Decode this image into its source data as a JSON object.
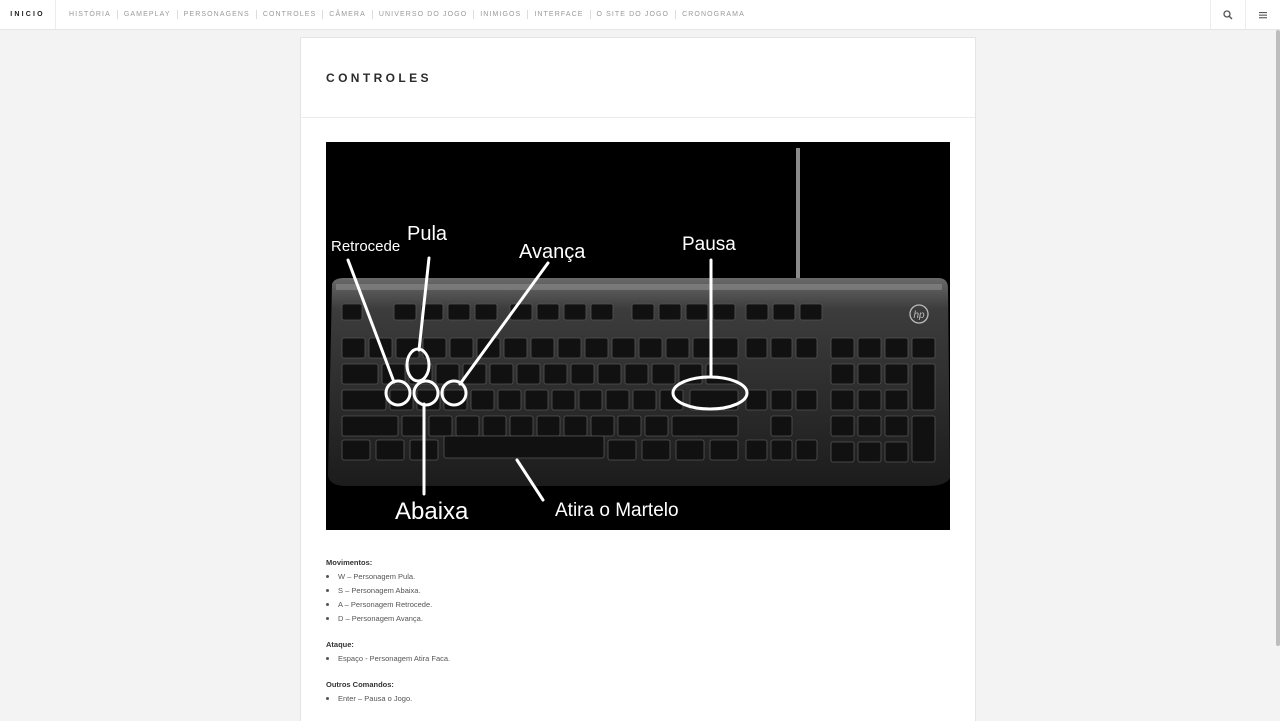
{
  "nav": {
    "brand": "INICIO",
    "links": [
      "HISTÓRIA",
      "GAMEPLAY",
      "PERSONAGENS",
      "CONTROLES",
      "CÂMERA",
      "UNIVERSO DO JOGO",
      "INIMIGOS",
      "INTERFACE",
      "O SITE DO JOGO",
      "CRONOGRAMA"
    ],
    "icons": [
      "search-icon",
      "menu-icon"
    ]
  },
  "page": {
    "title": "CONTROLES"
  },
  "figure": {
    "labels": {
      "retrocede": "Retrocede",
      "pula": "Pula",
      "avanca": "Avança",
      "pausa": "Pausa",
      "abaixa": "Abaixa",
      "atira": "Atira o Martelo"
    }
  },
  "sections": [
    {
      "title": "Movimentos:",
      "items": [
        "W – Personagem Pula.",
        "S – Personagem Abaixa.",
        "A – Personagem Retrocede.",
        "D – Personagem Avança."
      ]
    },
    {
      "title": "Ataque:",
      "items": [
        "Espaço - Personagem Atira Faca."
      ]
    },
    {
      "title": "Outros Comandos:",
      "items": [
        "Enter – Pausa o Jogo."
      ]
    }
  ],
  "colors": {
    "background": "#f3f3f3",
    "card": "#ffffff",
    "nav_text": "#999999",
    "title_text": "#2b2b2b"
  }
}
